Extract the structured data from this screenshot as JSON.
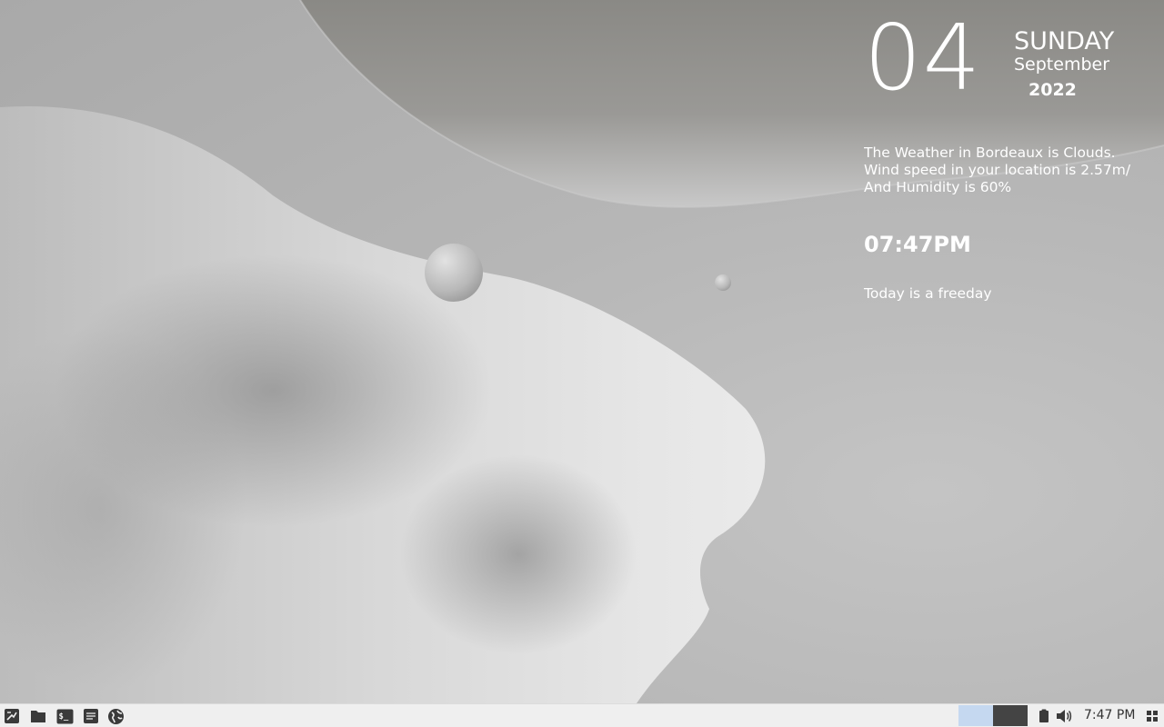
{
  "conky": {
    "day_number": "04",
    "weekday": "SUNDAY",
    "month": "September",
    "year": "2022",
    "weather_line1": "The Weather in Bordeaux is Clouds.",
    "weather_line2": "Wind speed in your location is 2.57m/",
    "weather_line3": "And Humidity is 60%",
    "time": "07:47PM",
    "status": "Today is a freeday"
  },
  "taskbar": {
    "launchers": [
      {
        "name": "app-menu",
        "icon": "app-menu-icon"
      },
      {
        "name": "file-manager",
        "icon": "folder-icon"
      },
      {
        "name": "terminal",
        "icon": "terminal-icon"
      },
      {
        "name": "text-editor",
        "icon": "text-editor-icon"
      },
      {
        "name": "web-browser",
        "icon": "globe-icon"
      }
    ],
    "workspaces": [
      {
        "id": 1,
        "active": true
      },
      {
        "id": 2,
        "active": false
      }
    ],
    "clock": "7:47 PM",
    "tray_icons": [
      "clipboard-icon",
      "volume-icon"
    ],
    "colors": {
      "panel_bg": "#efefef",
      "workspace_active": "#c5d8f0",
      "workspace_inactive": "#444444",
      "icon": "#3a3a3a"
    }
  }
}
